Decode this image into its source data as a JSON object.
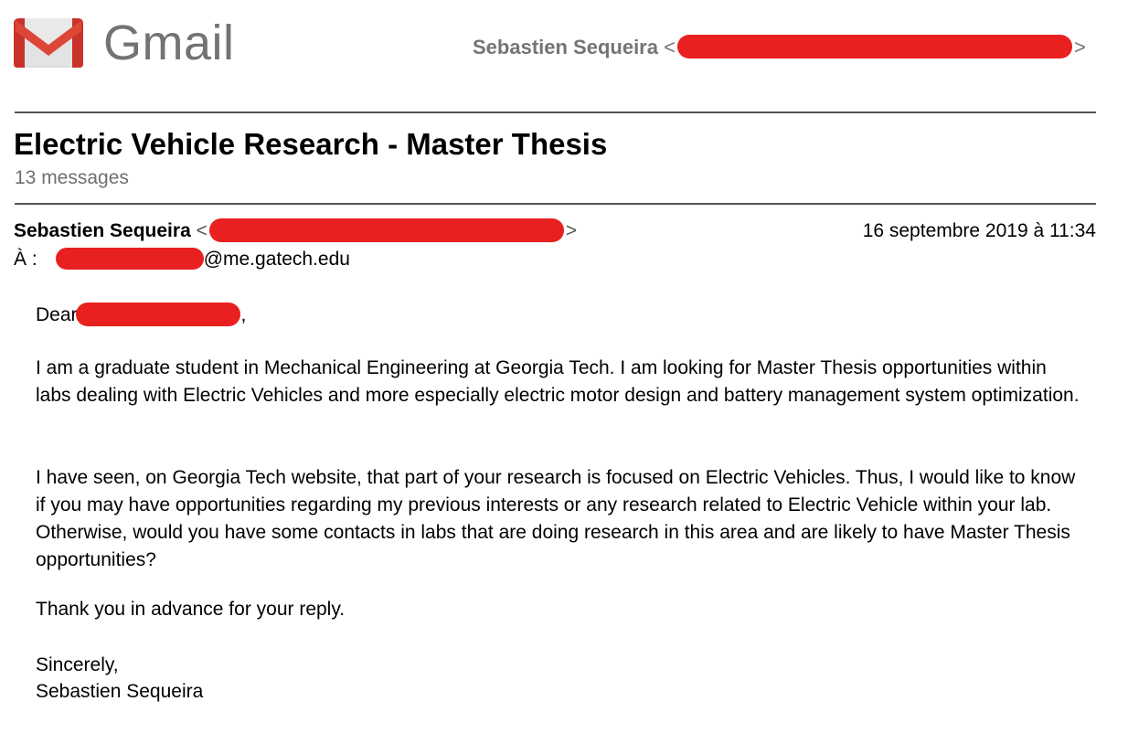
{
  "app": {
    "brand": "Gmail"
  },
  "account": {
    "name": "Sebastien Sequeira",
    "open_bracket": "<",
    "close_bracket": ">"
  },
  "thread": {
    "subject": "Electric Vehicle Research - Master Thesis",
    "message_count": "13 messages"
  },
  "message": {
    "sender_name": "Sebastien Sequeira",
    "sender_open_bracket": "<",
    "sender_close_bracket": ">",
    "date": "16 septembre 2019 à 11:34",
    "to_label": "À :",
    "to_domain": "@me.gatech.edu",
    "greeting_prefix": "Dear",
    "greeting_suffix": ",",
    "paragraph_1": "I am a graduate student in Mechanical Engineering at Georgia Tech. I am looking for Master Thesis opportunities within labs dealing with Electric Vehicles and more especially electric motor design and battery management system optimization.",
    "paragraph_2": "I have seen, on Georgia Tech website, that part of your research is focused on Electric Vehicles. Thus, I would like to know if you may have opportunities regarding my previous interests or any research related to Electric Vehicle within your lab. Otherwise, would you have some contacts in labs that are doing research in this area and are likely to have Master Thesis opportunities?",
    "paragraph_3": "Thank you in advance for your reply.",
    "closing": "Sincerely,",
    "signature": "Sebastien Sequeira"
  },
  "colors": {
    "redaction": "#e8201f",
    "brand_text": "#737373",
    "logo_red": "#db3a2e",
    "logo_dark_red": "#b3261e",
    "logo_grey": "#e0e0e0",
    "rule": "#555555"
  },
  "icons": {
    "logo": "gmail-m-logo-icon"
  }
}
